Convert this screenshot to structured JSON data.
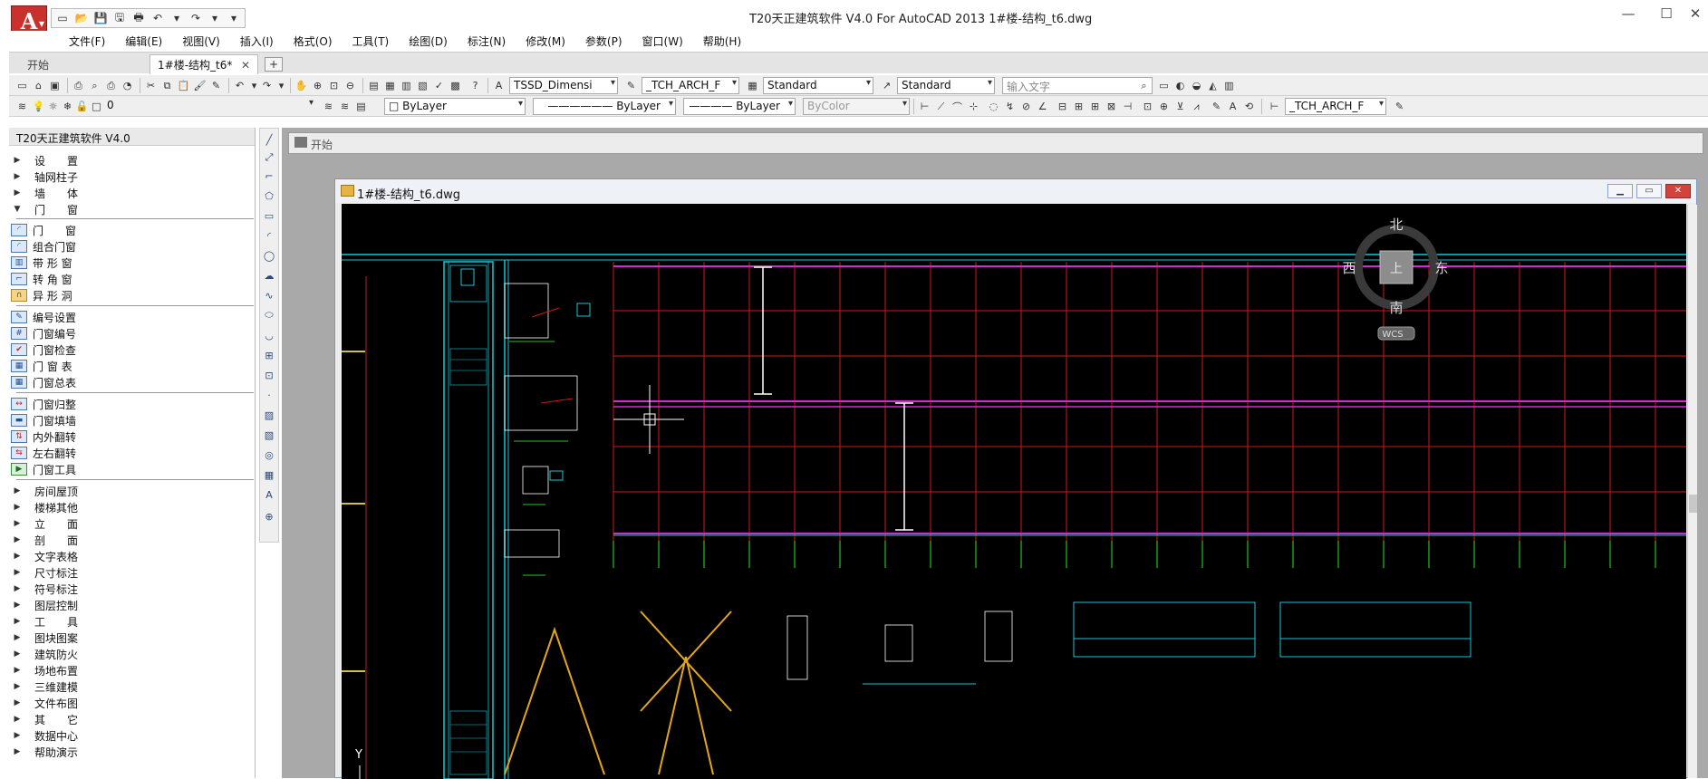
{
  "titlebar": {
    "title": "T20天正建筑软件 V4.0 For AutoCAD 2013      1#楼-结构_t6.dwg",
    "app_letter": "A",
    "minimize": "—",
    "maximize": "☐",
    "close": "✕"
  },
  "menu": [
    "文件(F)",
    "编辑(E)",
    "视图(V)",
    "插入(I)",
    "格式(O)",
    "工具(T)",
    "绘图(D)",
    "标注(N)",
    "修改(M)",
    "参数(P)",
    "窗口(W)",
    "帮助(H)"
  ],
  "tabs": {
    "start": "开始",
    "active": "1#楼-结构_t6*",
    "close": "✕",
    "add": "+"
  },
  "toolbar1": {
    "text_style": "TSSD_Dimensi",
    "dim_style": "_TCH_ARCH_F",
    "table_style": "Standard",
    "multileader_style": "Standard",
    "search_placeholder": "输入文字"
  },
  "toolbar2": {
    "layer": "0",
    "color": "ByLayer",
    "linetype": "ByLayer",
    "lineweight": "ByLayer",
    "plotstyle": "ByColor",
    "dim_style2": "_TCH_ARCH_F"
  },
  "leftpanel": {
    "title": "T20天正建筑软件 V4.0",
    "top_items": [
      {
        "label": "设　　置",
        "arrow": "▶"
      },
      {
        "label": "轴网柱子",
        "arrow": "▶"
      },
      {
        "label": "墙　　体",
        "arrow": "▶"
      },
      {
        "label": "门　　窗",
        "arrow": "▼"
      }
    ],
    "door_tools_a": [
      "门　　窗",
      "组合门窗",
      "带 形 窗",
      "转 角 窗",
      "异 形 洞"
    ],
    "door_tools_b": [
      "编号设置",
      "门窗编号",
      "门窗检查",
      "门 窗 表",
      "门窗总表"
    ],
    "door_tools_c": [
      "门窗归整",
      "门窗填墙",
      "内外翻转",
      "左右翻转",
      "门窗工具"
    ],
    "bottom_items": [
      "房间屋顶",
      "楼梯其他",
      "立　　面",
      "剖　　面",
      "文字表格",
      "尺寸标注",
      "符号标注",
      "图层控制",
      "工　　具",
      "图块图案",
      "建筑防火",
      "场地布置",
      "三维建模",
      "文件布图",
      "其　　它",
      "数据中心",
      "帮助演示"
    ]
  },
  "start_window": {
    "title": "开始"
  },
  "dwg_window": {
    "title": "1#楼-结构_t6.dwg",
    "btn_min": "▁",
    "btn_max": "▭",
    "btn_close": "✕"
  },
  "viewcube": {
    "north": "北",
    "south": "南",
    "west": "西",
    "east": "东",
    "top": "上",
    "wcs": "WCS"
  },
  "ucs": {
    "y": "Y"
  }
}
